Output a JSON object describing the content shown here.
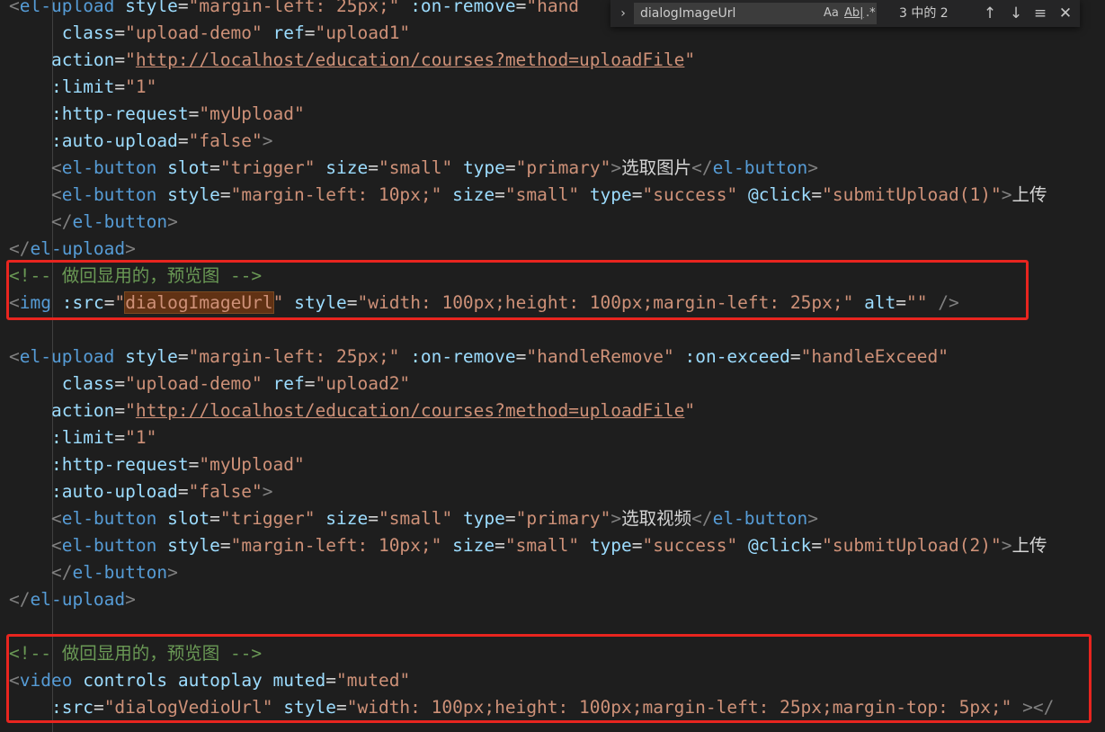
{
  "find_widget": {
    "toggle_icon": "chevron-right-icon",
    "query": "dialogImageUrl",
    "match_case_label": "Aa",
    "whole_word_label": "Ab|",
    "regex_label": ".*",
    "match_count": "3 中的 2",
    "prev_icon": "arrow-up-icon",
    "next_icon": "arrow-down-icon",
    "selection_icon": "lines-icon",
    "close_icon": "close-icon"
  },
  "annotation_color": "#e8251f",
  "code": {
    "lines": [
      [
        [
          "bracket",
          "<"
        ],
        [
          "tag",
          "el-upload"
        ],
        [
          "text",
          " "
        ],
        [
          "attr",
          "style"
        ],
        [
          "text",
          "="
        ],
        [
          "str",
          "\"margin-left: 25px;\""
        ],
        [
          "text",
          " "
        ],
        [
          "attr",
          ":on-remove"
        ],
        [
          "text",
          "="
        ],
        [
          "str",
          "\"hand"
        ]
      ],
      [
        [
          "text",
          "     "
        ],
        [
          "attr",
          "class"
        ],
        [
          "text",
          "="
        ],
        [
          "str",
          "\"upload-demo\""
        ],
        [
          "text",
          " "
        ],
        [
          "attr",
          "ref"
        ],
        [
          "text",
          "="
        ],
        [
          "str",
          "\"upload1\""
        ]
      ],
      [
        [
          "text",
          "    "
        ],
        [
          "attr",
          "action"
        ],
        [
          "text",
          "="
        ],
        [
          "str",
          "\""
        ],
        [
          "url",
          "http://localhost/education/courses?method=uploadFile"
        ],
        [
          "str",
          "\""
        ]
      ],
      [
        [
          "text",
          "    "
        ],
        [
          "attr",
          ":limit"
        ],
        [
          "text",
          "="
        ],
        [
          "str",
          "\"1\""
        ]
      ],
      [
        [
          "text",
          "    "
        ],
        [
          "attr",
          ":http-request"
        ],
        [
          "text",
          "="
        ],
        [
          "str",
          "\"myUpload\""
        ]
      ],
      [
        [
          "text",
          "    "
        ],
        [
          "attr",
          ":auto-upload"
        ],
        [
          "text",
          "="
        ],
        [
          "str",
          "\"false\""
        ],
        [
          "bracket",
          ">"
        ]
      ],
      [
        [
          "text",
          "    "
        ],
        [
          "bracket",
          "<"
        ],
        [
          "tag",
          "el-button"
        ],
        [
          "text",
          " "
        ],
        [
          "attr",
          "slot"
        ],
        [
          "text",
          "="
        ],
        [
          "str",
          "\"trigger\""
        ],
        [
          "text",
          " "
        ],
        [
          "attr",
          "size"
        ],
        [
          "text",
          "="
        ],
        [
          "str",
          "\"small\""
        ],
        [
          "text",
          " "
        ],
        [
          "attr",
          "type"
        ],
        [
          "text",
          "="
        ],
        [
          "str",
          "\"primary\""
        ],
        [
          "bracket",
          ">"
        ],
        [
          "text",
          "选取图片"
        ],
        [
          "bracket",
          "</"
        ],
        [
          "tag",
          "el-button"
        ],
        [
          "bracket",
          ">"
        ]
      ],
      [
        [
          "text",
          "    "
        ],
        [
          "bracket",
          "<"
        ],
        [
          "tag",
          "el-button"
        ],
        [
          "text",
          " "
        ],
        [
          "attr",
          "style"
        ],
        [
          "text",
          "="
        ],
        [
          "str",
          "\"margin-left: 10px;\""
        ],
        [
          "text",
          " "
        ],
        [
          "attr",
          "size"
        ],
        [
          "text",
          "="
        ],
        [
          "str",
          "\"small\""
        ],
        [
          "text",
          " "
        ],
        [
          "attr",
          "type"
        ],
        [
          "text",
          "="
        ],
        [
          "str",
          "\"success\""
        ],
        [
          "text",
          " "
        ],
        [
          "attr",
          "@click"
        ],
        [
          "text",
          "="
        ],
        [
          "str",
          "\"submitUpload(1)\""
        ],
        [
          "bracket",
          ">"
        ],
        [
          "text",
          "上传"
        ]
      ],
      [
        [
          "text",
          "    "
        ],
        [
          "bracket",
          "</"
        ],
        [
          "tag",
          "el-button"
        ],
        [
          "bracket",
          ">"
        ]
      ],
      [
        [
          "bracket",
          "</"
        ],
        [
          "tag",
          "el-upload"
        ],
        [
          "bracket",
          ">"
        ]
      ],
      [
        [
          "comment",
          "<!-- 做回显用的，预览图 -->"
        ]
      ],
      [
        [
          "bracket",
          "<"
        ],
        [
          "tag",
          "img"
        ],
        [
          "text",
          " "
        ],
        [
          "attr",
          ":src"
        ],
        [
          "text",
          "="
        ],
        [
          "str",
          "\""
        ],
        [
          "match",
          "dialogImageUrl"
        ],
        [
          "str",
          "\""
        ],
        [
          "text",
          " "
        ],
        [
          "attr",
          "style"
        ],
        [
          "text",
          "="
        ],
        [
          "str",
          "\"width: 100px;height: 100px;margin-left: 25px;\""
        ],
        [
          "text",
          " "
        ],
        [
          "attr",
          "alt"
        ],
        [
          "text",
          "="
        ],
        [
          "str",
          "\"\""
        ],
        [
          "text",
          " "
        ],
        [
          "bracket",
          "/>"
        ]
      ],
      [],
      [
        [
          "bracket",
          "<"
        ],
        [
          "tag",
          "el-upload"
        ],
        [
          "text",
          " "
        ],
        [
          "attr",
          "style"
        ],
        [
          "text",
          "="
        ],
        [
          "str",
          "\"margin-left: 25px;\""
        ],
        [
          "text",
          " "
        ],
        [
          "attr",
          ":on-remove"
        ],
        [
          "text",
          "="
        ],
        [
          "str",
          "\"handleRemove\""
        ],
        [
          "text",
          " "
        ],
        [
          "attr",
          ":on-exceed"
        ],
        [
          "text",
          "="
        ],
        [
          "str",
          "\"handleExceed\""
        ]
      ],
      [
        [
          "text",
          "     "
        ],
        [
          "attr",
          "class"
        ],
        [
          "text",
          "="
        ],
        [
          "str",
          "\"upload-demo\""
        ],
        [
          "text",
          " "
        ],
        [
          "attr",
          "ref"
        ],
        [
          "text",
          "="
        ],
        [
          "str",
          "\"upload2\""
        ]
      ],
      [
        [
          "text",
          "    "
        ],
        [
          "attr",
          "action"
        ],
        [
          "text",
          "="
        ],
        [
          "str",
          "\""
        ],
        [
          "url",
          "http://localhost/education/courses?method=uploadFile"
        ],
        [
          "str",
          "\""
        ]
      ],
      [
        [
          "text",
          "    "
        ],
        [
          "attr",
          ":limit"
        ],
        [
          "text",
          "="
        ],
        [
          "str",
          "\"1\""
        ]
      ],
      [
        [
          "text",
          "    "
        ],
        [
          "attr",
          ":http-request"
        ],
        [
          "text",
          "="
        ],
        [
          "str",
          "\"myUpload\""
        ]
      ],
      [
        [
          "text",
          "    "
        ],
        [
          "attr",
          ":auto-upload"
        ],
        [
          "text",
          "="
        ],
        [
          "str",
          "\"false\""
        ],
        [
          "bracket",
          ">"
        ]
      ],
      [
        [
          "text",
          "    "
        ],
        [
          "bracket",
          "<"
        ],
        [
          "tag",
          "el-button"
        ],
        [
          "text",
          " "
        ],
        [
          "attr",
          "slot"
        ],
        [
          "text",
          "="
        ],
        [
          "str",
          "\"trigger\""
        ],
        [
          "text",
          " "
        ],
        [
          "attr",
          "size"
        ],
        [
          "text",
          "="
        ],
        [
          "str",
          "\"small\""
        ],
        [
          "text",
          " "
        ],
        [
          "attr",
          "type"
        ],
        [
          "text",
          "="
        ],
        [
          "str",
          "\"primary\""
        ],
        [
          "bracket",
          ">"
        ],
        [
          "text",
          "选取视频"
        ],
        [
          "bracket",
          "</"
        ],
        [
          "tag",
          "el-button"
        ],
        [
          "bracket",
          ">"
        ]
      ],
      [
        [
          "text",
          "    "
        ],
        [
          "bracket",
          "<"
        ],
        [
          "tag",
          "el-button"
        ],
        [
          "text",
          " "
        ],
        [
          "attr",
          "style"
        ],
        [
          "text",
          "="
        ],
        [
          "str",
          "\"margin-left: 10px;\""
        ],
        [
          "text",
          " "
        ],
        [
          "attr",
          "size"
        ],
        [
          "text",
          "="
        ],
        [
          "str",
          "\"small\""
        ],
        [
          "text",
          " "
        ],
        [
          "attr",
          "type"
        ],
        [
          "text",
          "="
        ],
        [
          "str",
          "\"success\""
        ],
        [
          "text",
          " "
        ],
        [
          "attr",
          "@click"
        ],
        [
          "text",
          "="
        ],
        [
          "str",
          "\"submitUpload(2)\""
        ],
        [
          "bracket",
          ">"
        ],
        [
          "text",
          "上传"
        ]
      ],
      [
        [
          "text",
          "    "
        ],
        [
          "bracket",
          "</"
        ],
        [
          "tag",
          "el-button"
        ],
        [
          "bracket",
          ">"
        ]
      ],
      [
        [
          "bracket",
          "</"
        ],
        [
          "tag",
          "el-upload"
        ],
        [
          "bracket",
          ">"
        ]
      ],
      [],
      [
        [
          "comment",
          "<!-- 做回显用的，预览图 -->"
        ]
      ],
      [
        [
          "bracket",
          "<"
        ],
        [
          "tag",
          "video"
        ],
        [
          "text",
          " "
        ],
        [
          "attr",
          "controls"
        ],
        [
          "text",
          " "
        ],
        [
          "attr",
          "autoplay"
        ],
        [
          "text",
          " "
        ],
        [
          "attr",
          "muted"
        ],
        [
          "text",
          "="
        ],
        [
          "str",
          "\"muted\""
        ]
      ],
      [
        [
          "text",
          "    "
        ],
        [
          "attr",
          ":src"
        ],
        [
          "text",
          "="
        ],
        [
          "str",
          "\"dialogVedioUrl\""
        ],
        [
          "text",
          " "
        ],
        [
          "attr",
          "style"
        ],
        [
          "text",
          "="
        ],
        [
          "str",
          "\"width: 100px;height: 100px;margin-left: 25px;margin-top: 5px;\""
        ],
        [
          "text",
          " "
        ],
        [
          "bracket",
          "></"
        ]
      ]
    ]
  }
}
